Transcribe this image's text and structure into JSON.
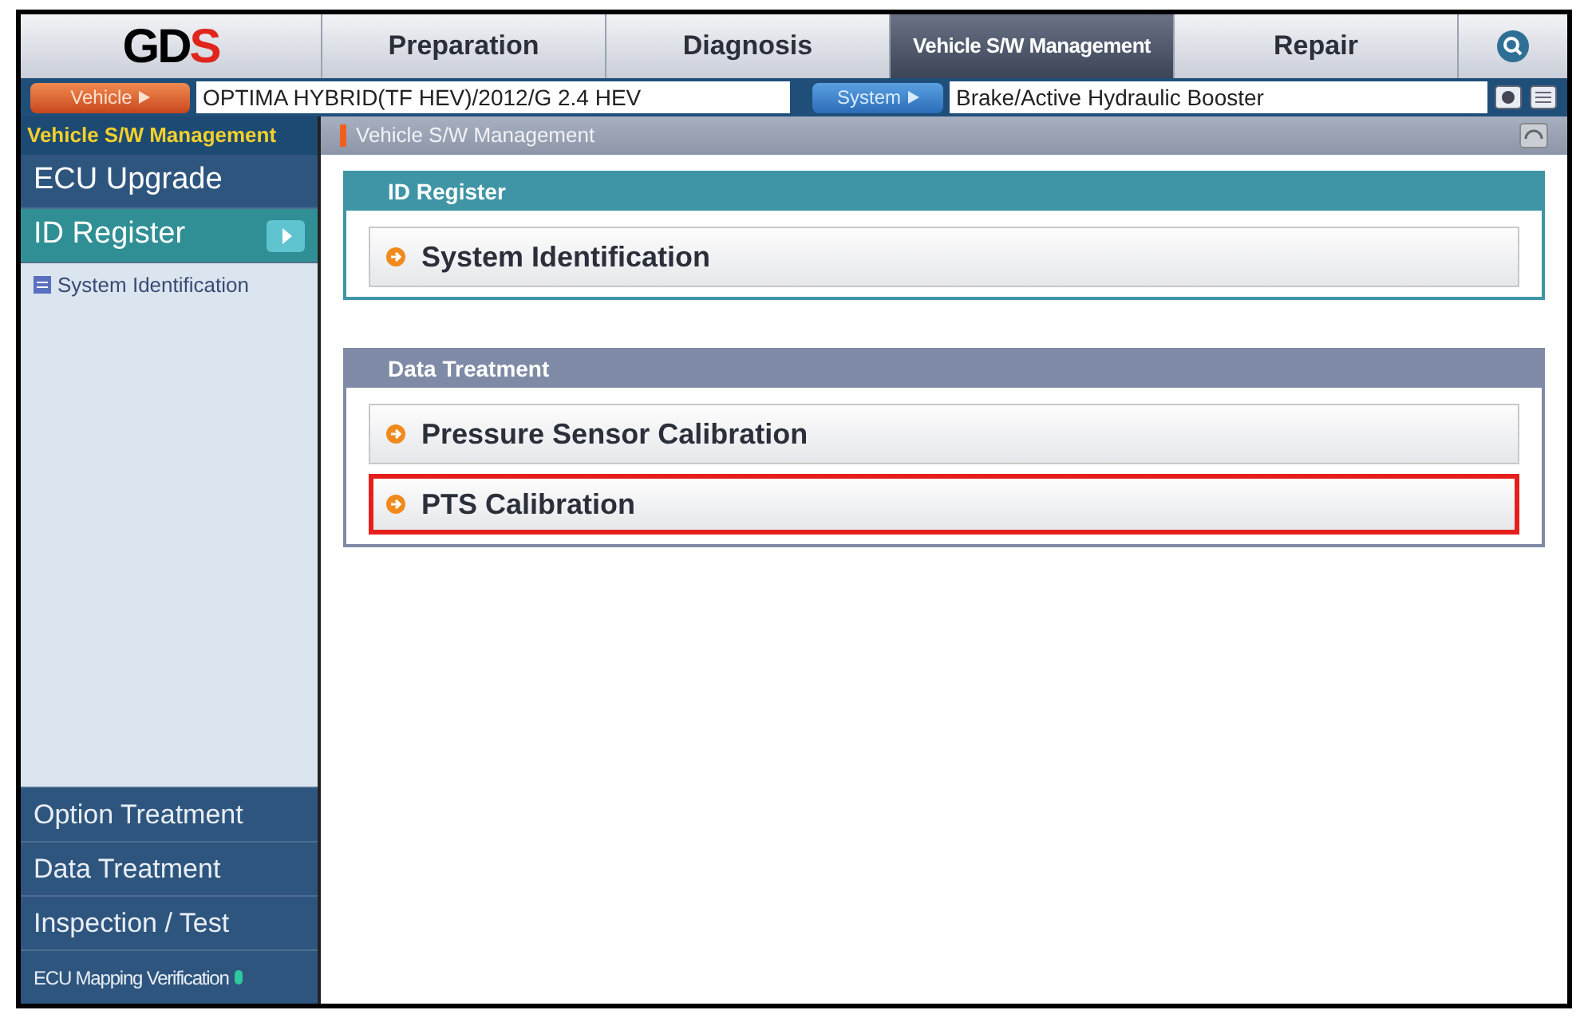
{
  "logo": {
    "text": "GD",
    "accent": "S"
  },
  "tabs": [
    {
      "label": "Preparation",
      "selected": false
    },
    {
      "label": "Diagnosis",
      "selected": false
    },
    {
      "label": "Vehicle S/W Management",
      "selected": true
    },
    {
      "label": "Repair",
      "selected": false
    }
  ],
  "vehicle": {
    "button": "Vehicle",
    "value": "OPTIMA HYBRID(TF HEV)/2012/G 2.4 HEV"
  },
  "system": {
    "button": "System",
    "value": "Brake/Active Hydraulic Booster"
  },
  "sidebar": {
    "title": "Vehicle S/W Management",
    "items": [
      {
        "label": "ECU Upgrade",
        "selected": false
      },
      {
        "label": "ID Register",
        "selected": true,
        "children": [
          {
            "label": "System Identification"
          }
        ]
      }
    ],
    "bottom_items": [
      {
        "label": "Option Treatment",
        "small": false
      },
      {
        "label": "Data Treatment",
        "small": false
      },
      {
        "label": "Inspection / Test",
        "small": false
      },
      {
        "label": "ECU Mapping Verification",
        "small": true
      }
    ]
  },
  "breadcrumb": "Vehicle S/W Management",
  "sections": [
    {
      "title": "ID Register",
      "color": "#3f95a5",
      "items": [
        {
          "label": "System Identification",
          "highlighted": false
        }
      ]
    },
    {
      "title": "Data Treatment",
      "color": "#7f8ba6",
      "items": [
        {
          "label": "Pressure Sensor Calibration",
          "highlighted": false
        },
        {
          "label": "PTS Calibration",
          "highlighted": true
        }
      ]
    }
  ]
}
